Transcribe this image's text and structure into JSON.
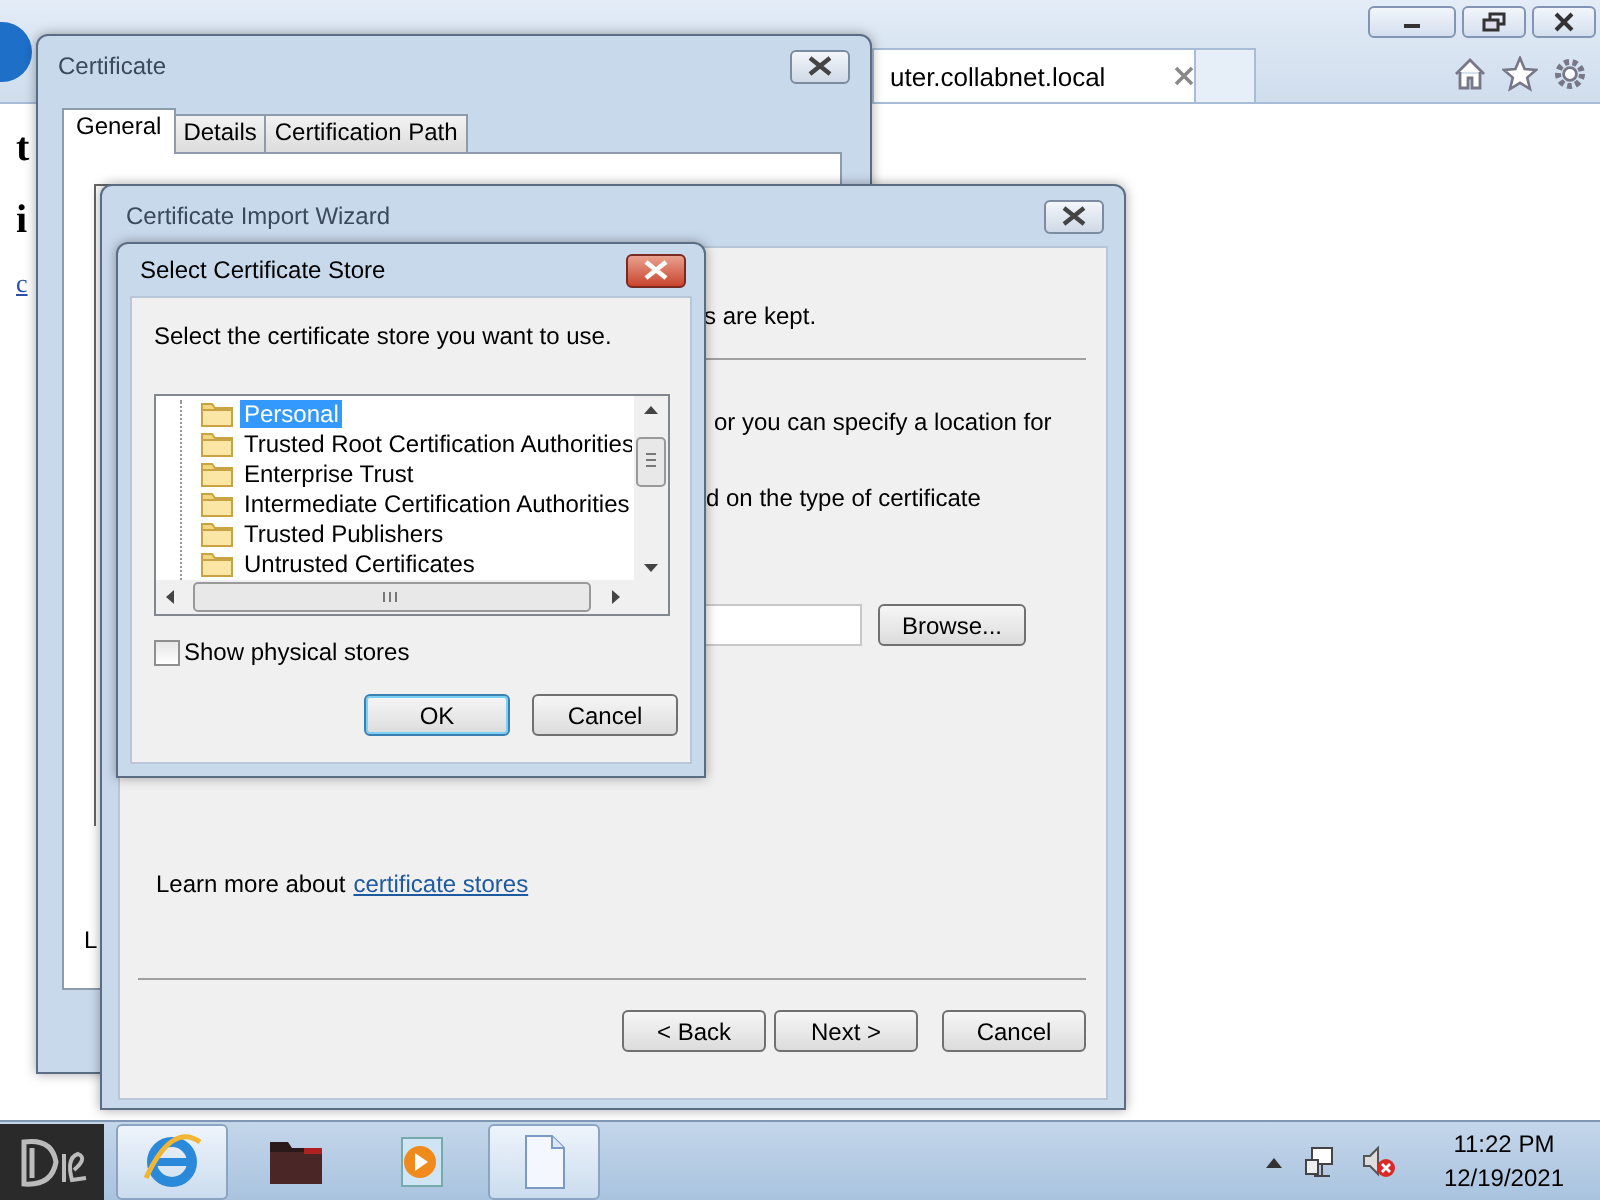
{
  "browser": {
    "tab": {
      "title": "uter.collabnet.local"
    },
    "page_texts": [
      {
        "text": "t",
        "kind": "heading"
      },
      {
        "text": "i",
        "kind": "heading"
      },
      {
        "text": "c",
        "kind": "link"
      }
    ]
  },
  "certificate_window": {
    "title": "Certificate",
    "tabs": [
      {
        "label": "General",
        "selected": true
      },
      {
        "label": "Details",
        "selected": false
      },
      {
        "label": "Certification Path",
        "selected": false
      }
    ],
    "body_text": "L"
  },
  "import_wizard": {
    "title": "Certificate Import Wizard",
    "lines": [
      "s are kept.",
      "or you can specify a location for",
      "d on the type of certificate"
    ],
    "browse_button": "Browse...",
    "learn_more": {
      "text": "Learn more about",
      "link": "certificate stores"
    },
    "buttons": [
      "< Back",
      "Next >",
      "Cancel"
    ]
  },
  "select_store_dialog": {
    "title": "Select Certificate Store",
    "prompt": "Select the certificate store you want to use.",
    "stores": [
      {
        "label": "Personal",
        "selected": true
      },
      {
        "label": "Trusted Root Certification Authorities",
        "selected": false
      },
      {
        "label": "Enterprise Trust",
        "selected": false
      },
      {
        "label": "Intermediate Certification Authorities",
        "selected": false
      },
      {
        "label": "Trusted Publishers",
        "selected": false
      },
      {
        "label": "Untrusted Certificates",
        "selected": false
      }
    ],
    "show_physical_stores": {
      "label": "Show physical stores",
      "checked": false
    },
    "buttons": [
      "OK",
      "Cancel"
    ]
  },
  "taskbar": {
    "apps": [
      {
        "kind": "browser",
        "active": true
      },
      {
        "kind": "folder",
        "active": false
      },
      {
        "kind": "media",
        "active": false
      },
      {
        "kind": "document",
        "active": true
      }
    ],
    "clock": {
      "time": "11:22 PM",
      "date": "12/19/2021"
    }
  }
}
